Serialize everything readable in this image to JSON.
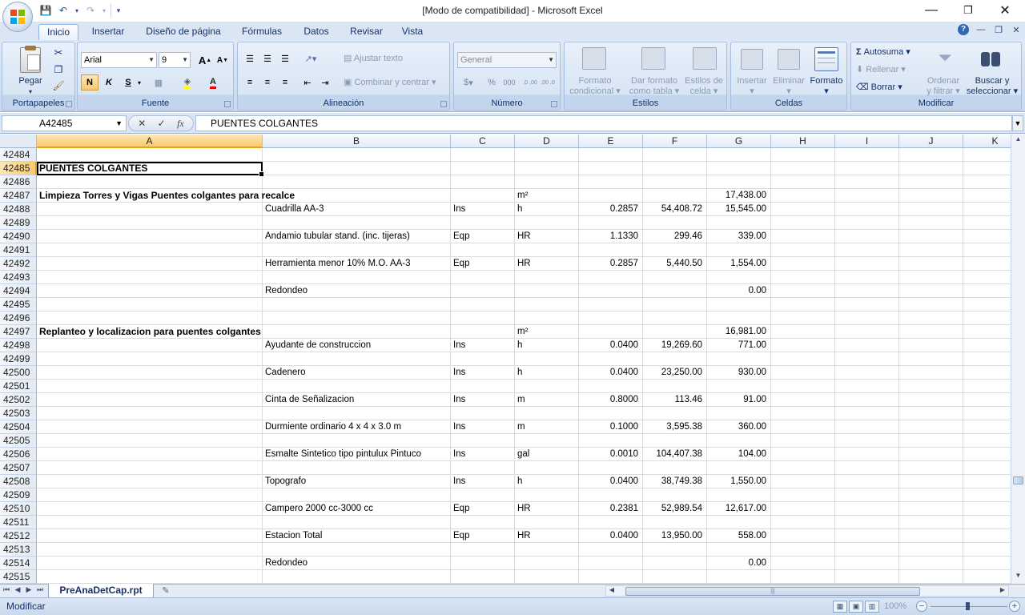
{
  "window": {
    "title": "[Modo de compatibilidad] - Microsoft Excel",
    "min_label": "—",
    "max_label": "❐",
    "close_label": "✕"
  },
  "qat": {
    "save": "💾",
    "undo": "↶",
    "redo": "↷",
    "customize": "▾"
  },
  "tabs": [
    "Inicio",
    "Insertar",
    "Diseño de página",
    "Fórmulas",
    "Datos",
    "Revisar",
    "Vista"
  ],
  "ribbon": {
    "portapapeles": {
      "label": "Portapapeles",
      "paste": "Pegar"
    },
    "fuente": {
      "label": "Fuente",
      "font": "Arial",
      "size": "9",
      "bold": "N",
      "italic": "K",
      "underline": "S",
      "grow": "A",
      "shrink": "A"
    },
    "alineacion": {
      "label": "Alineación",
      "wrap": "Ajustar texto",
      "merge": "Combinar y centrar"
    },
    "numero": {
      "label": "Número",
      "format": "General",
      "currency": "$",
      "percent": "%",
      "thousands": "000",
      "inc_dec": ",0 ,00",
      "dec_dec": ",00 ,0"
    },
    "estilos": {
      "label": "Estilos",
      "cond_1": "Formato",
      "cond_2": "condicional",
      "table_1": "Dar formato",
      "table_2": "como tabla",
      "cell_1": "Estilos de",
      "cell_2": "celda"
    },
    "celdas": {
      "label": "Celdas",
      "insert": "Insertar",
      "delete": "Eliminar",
      "format": "Formato"
    },
    "modificar": {
      "label": "Modificar",
      "autosum": "Autosuma",
      "fill": "Rellenar",
      "clear": "Borrar",
      "sort_1": "Ordenar",
      "sort_2": "y filtrar",
      "find_1": "Buscar y",
      "find_2": "seleccionar"
    }
  },
  "formula_bar": {
    "name_box": "A42485",
    "cancel": "✕",
    "enter": "✓",
    "fx": "fx",
    "value": "PUENTES COLGANTES"
  },
  "columns": [
    "A",
    "B",
    "C",
    "D",
    "E",
    "F",
    "G",
    "H",
    "I",
    "J",
    "K"
  ],
  "rows": [
    {
      "n": "42484",
      "a": "",
      "b": "",
      "c": "",
      "d": "",
      "e": "",
      "f": "",
      "g": ""
    },
    {
      "n": "42485",
      "a": "PUENTES COLGANTES",
      "b": "",
      "c": "",
      "d": "",
      "e": "",
      "f": "",
      "g": "",
      "active": true,
      "bold": true
    },
    {
      "n": "42486",
      "a": "",
      "b": "",
      "c": "",
      "d": "",
      "e": "",
      "f": "",
      "g": ""
    },
    {
      "n": "42487",
      "a": "Limpieza Torres y Vigas Puentes colgantes para recalce",
      "b": "",
      "c": "",
      "d": "m²",
      "e": "",
      "f": "",
      "g": "17,438.00",
      "bold": true
    },
    {
      "n": "42488",
      "a": "",
      "b": "Cuadrilla AA-3",
      "c": "Ins",
      "d": "h",
      "e": "0.2857",
      "f": "54,408.72",
      "g": "15,545.00"
    },
    {
      "n": "42489",
      "a": "",
      "b": "",
      "c": "",
      "d": "",
      "e": "",
      "f": "",
      "g": ""
    },
    {
      "n": "42490",
      "a": "",
      "b": "Andamio tubular stand. (inc. tijeras)",
      "c": "Eqp",
      "d": "HR",
      "e": "1.1330",
      "f": "299.46",
      "g": "339.00"
    },
    {
      "n": "42491",
      "a": "",
      "b": "",
      "c": "",
      "d": "",
      "e": "",
      "f": "",
      "g": ""
    },
    {
      "n": "42492",
      "a": "",
      "b": "Herramienta menor 10% M.O. AA-3",
      "c": "Eqp",
      "d": "HR",
      "e": "0.2857",
      "f": "5,440.50",
      "g": "1,554.00"
    },
    {
      "n": "42493",
      "a": "",
      "b": "",
      "c": "",
      "d": "",
      "e": "",
      "f": "",
      "g": ""
    },
    {
      "n": "42494",
      "a": "",
      "b": "Redondeo",
      "c": "",
      "d": "",
      "e": "",
      "f": "",
      "g": "0.00"
    },
    {
      "n": "42495",
      "a": "",
      "b": "",
      "c": "",
      "d": "",
      "e": "",
      "f": "",
      "g": ""
    },
    {
      "n": "42496",
      "a": "",
      "b": "",
      "c": "",
      "d": "",
      "e": "",
      "f": "",
      "g": ""
    },
    {
      "n": "42497",
      "a": "Replanteo y localizacion  para puentes colgantes",
      "b": "",
      "c": "",
      "d": "m²",
      "e": "",
      "f": "",
      "g": "16,981.00",
      "bold": true
    },
    {
      "n": "42498",
      "a": "",
      "b": "Ayudante de construccion",
      "c": "Ins",
      "d": "h",
      "e": "0.0400",
      "f": "19,269.60",
      "g": "771.00"
    },
    {
      "n": "42499",
      "a": "",
      "b": "",
      "c": "",
      "d": "",
      "e": "",
      "f": "",
      "g": ""
    },
    {
      "n": "42500",
      "a": "",
      "b": "Cadenero",
      "c": "Ins",
      "d": "h",
      "e": "0.0400",
      "f": "23,250.00",
      "g": "930.00"
    },
    {
      "n": "42501",
      "a": "",
      "b": "",
      "c": "",
      "d": "",
      "e": "",
      "f": "",
      "g": ""
    },
    {
      "n": "42502",
      "a": "",
      "b": "Cinta de Señalizacion",
      "c": "Ins",
      "d": "m",
      "e": "0.8000",
      "f": "113.46",
      "g": "91.00"
    },
    {
      "n": "42503",
      "a": "",
      "b": "",
      "c": "",
      "d": "",
      "e": "",
      "f": "",
      "g": ""
    },
    {
      "n": "42504",
      "a": "",
      "b": "Durmiente ordinario 4 x 4 x 3.0 m",
      "c": "Ins",
      "d": "m",
      "e": "0.1000",
      "f": "3,595.38",
      "g": "360.00"
    },
    {
      "n": "42505",
      "a": "",
      "b": "",
      "c": "",
      "d": "",
      "e": "",
      "f": "",
      "g": ""
    },
    {
      "n": "42506",
      "a": "",
      "b": "Esmalte Sintetico tipo pintulux Pintuco",
      "c": "Ins",
      "d": "gal",
      "e": "0.0010",
      "f": "104,407.38",
      "g": "104.00"
    },
    {
      "n": "42507",
      "a": "",
      "b": "",
      "c": "",
      "d": "",
      "e": "",
      "f": "",
      "g": ""
    },
    {
      "n": "42508",
      "a": "",
      "b": "Topografo",
      "c": "Ins",
      "d": "h",
      "e": "0.0400",
      "f": "38,749.38",
      "g": "1,550.00"
    },
    {
      "n": "42509",
      "a": "",
      "b": "",
      "c": "",
      "d": "",
      "e": "",
      "f": "",
      "g": ""
    },
    {
      "n": "42510",
      "a": "",
      "b": "Campero 2000 cc-3000 cc",
      "c": "Eqp",
      "d": "HR",
      "e": "0.2381",
      "f": "52,989.54",
      "g": "12,617.00"
    },
    {
      "n": "42511",
      "a": "",
      "b": "",
      "c": "",
      "d": "",
      "e": "",
      "f": "",
      "g": ""
    },
    {
      "n": "42512",
      "a": "",
      "b": "Estacion Total",
      "c": "Eqp",
      "d": "HR",
      "e": "0.0400",
      "f": "13,950.00",
      "g": "558.00"
    },
    {
      "n": "42513",
      "a": "",
      "b": "",
      "c": "",
      "d": "",
      "e": "",
      "f": "",
      "g": ""
    },
    {
      "n": "42514",
      "a": "",
      "b": "Redondeo",
      "c": "",
      "d": "",
      "e": "",
      "f": "",
      "g": "0.00"
    },
    {
      "n": "42515",
      "a": "",
      "b": "",
      "c": "",
      "d": "",
      "e": "",
      "f": "",
      "g": ""
    }
  ],
  "sheet": {
    "tab_name": "PreAnaDetCap.rpt",
    "nav_first": "⏮",
    "nav_prev": "◀",
    "nav_next": "▶",
    "nav_last": "⏭"
  },
  "status": {
    "mode": "Modificar",
    "zoom": "100%"
  },
  "colors": {
    "accent": "#f8c971",
    "ribbon_bg": "#dbe6f4",
    "header_text": "#15316b"
  }
}
